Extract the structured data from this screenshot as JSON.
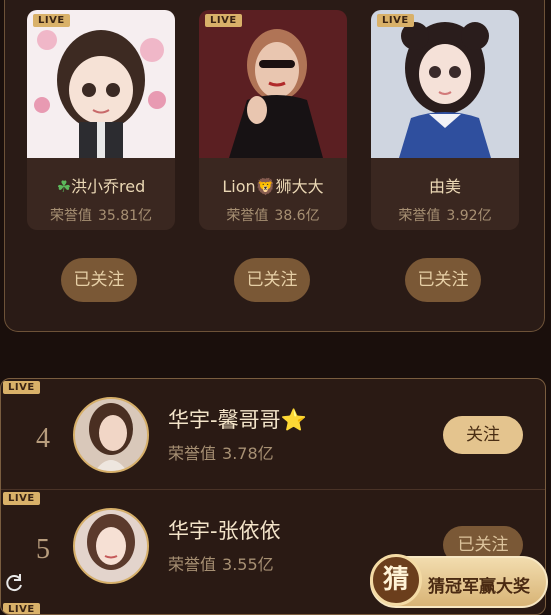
{
  "live_label": "LIVE",
  "top3": [
    {
      "name": "洪小乔red",
      "name_icon": "clover-icon",
      "honor_label": "荣誉值",
      "honor_value": "35.81亿",
      "follow_label": "已关注"
    },
    {
      "name": "Lion",
      "name_suffix": "狮大大",
      "name_icon": "lion-icon",
      "honor_label": "荣誉值",
      "honor_value": "38.6亿",
      "follow_label": "已关注"
    },
    {
      "name": "由美",
      "honor_label": "荣誉值",
      "honor_value": "3.92亿",
      "follow_label": "已关注"
    }
  ],
  "list": [
    {
      "rank": "4",
      "name": "华宇-馨哥哥",
      "name_icon": "star-icon",
      "honor_label": "荣誉值",
      "honor_value": "3.78亿",
      "action_label": "关注"
    },
    {
      "rank": "5",
      "name": "华宇-张依依",
      "honor_label": "荣誉值",
      "honor_value": "3.55亿",
      "action_label": "已关注"
    }
  ],
  "promo": {
    "badge": "猜",
    "text": "猜冠军赢大奖"
  },
  "colors": {
    "gold": "#d9b169",
    "background": "#1a0f0c",
    "button_brown": "#7a5836"
  }
}
